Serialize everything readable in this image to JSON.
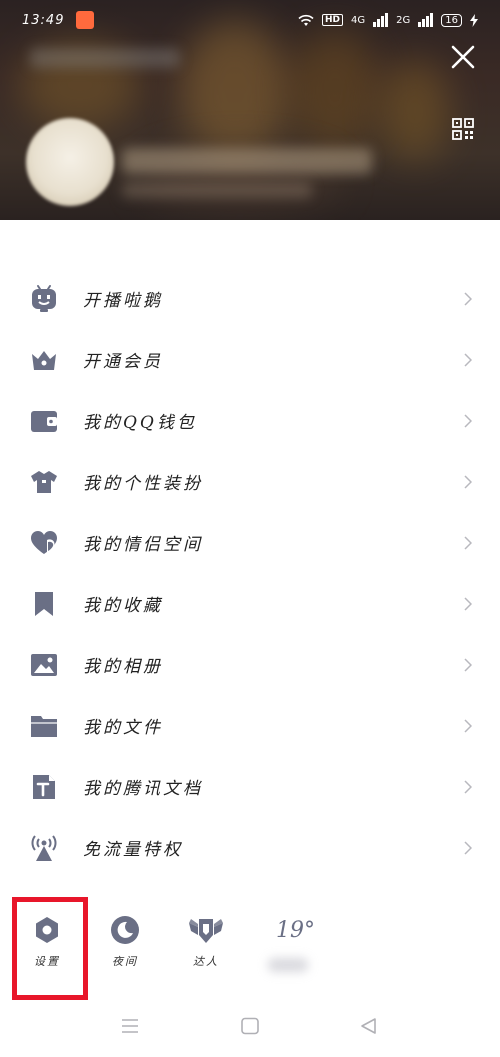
{
  "status_bar": {
    "time": "13:49",
    "hd_label": "HD",
    "net_1": "4G",
    "net_2": "2G",
    "battery": "16"
  },
  "menu": {
    "items": [
      {
        "label": "开播啦鹅",
        "icon": "live-robot-icon"
      },
      {
        "label": "开通会员",
        "icon": "crown-icon"
      },
      {
        "label": "我的QQ钱包",
        "icon": "wallet-icon"
      },
      {
        "label": "我的个性装扮",
        "icon": "tshirt-icon"
      },
      {
        "label": "我的情侣空间",
        "icon": "heart-icon"
      },
      {
        "label": "我的收藏",
        "icon": "bookmark-icon"
      },
      {
        "label": "我的相册",
        "icon": "photo-icon"
      },
      {
        "label": "我的文件",
        "icon": "folder-icon"
      },
      {
        "label": "我的腾讯文档",
        "icon": "document-icon"
      },
      {
        "label": "免流量特权",
        "icon": "signal-tower-icon"
      }
    ]
  },
  "toolbar": {
    "settings_label": "设置",
    "night_label": "夜间",
    "expert_label": "达人",
    "weather_temp": "19°"
  },
  "colors": {
    "icon": "#6a6f85",
    "chevron": "#b8b8be",
    "highlight": "#e8162a"
  }
}
